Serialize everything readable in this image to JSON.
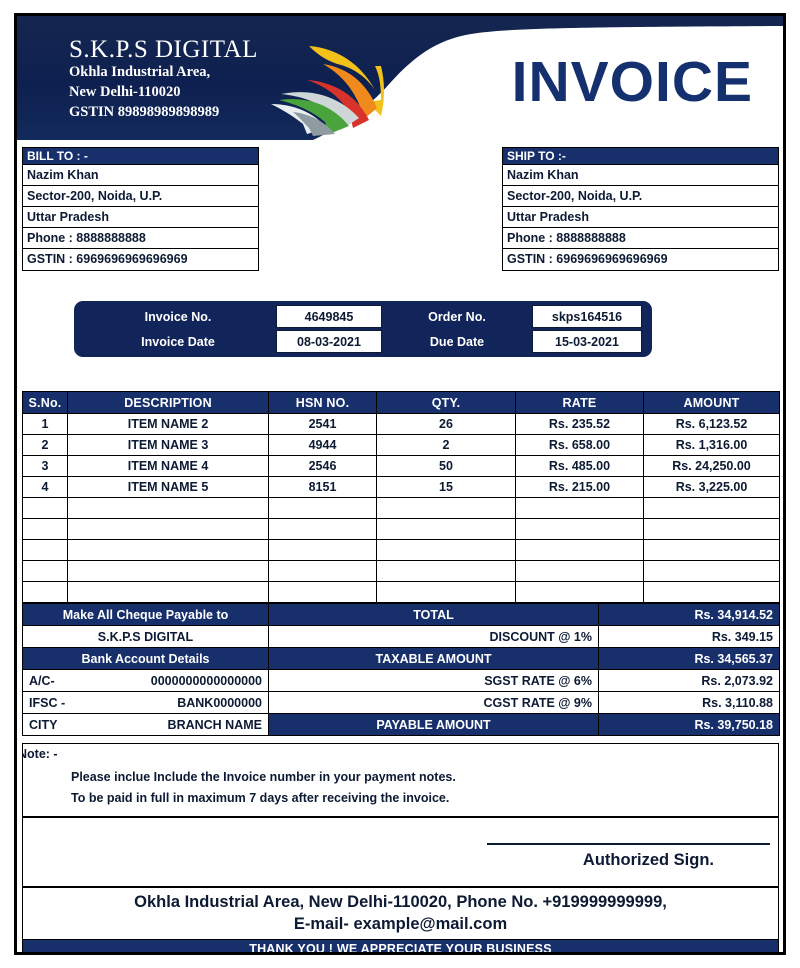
{
  "company": {
    "name": "S.K.P.S DIGITAL",
    "address_line1": "Okhla Industrial Area,",
    "address_line2": "New Delhi-110020",
    "gstin": "GSTIN 89898989898989"
  },
  "document": {
    "title": "INVOICE"
  },
  "bill_to": {
    "heading": "BILL TO : -",
    "name": "Nazim Khan",
    "address": "Sector-200, Noida, U.P.",
    "state": "Uttar Pradesh",
    "phone": "Phone : 8888888888",
    "gstin": "GSTIN : 6969696969696969"
  },
  "ship_to": {
    "heading": "SHIP TO  :-",
    "name": "Nazim Khan",
    "address": "Sector-200, Noida, U.P.",
    "state": "Uttar Pradesh",
    "phone": "Phone : 8888888888",
    "gstin": "GSTIN : 6969696969696969"
  },
  "meta": {
    "invoice_no_label": "Invoice No.",
    "invoice_no_value": "4649845",
    "order_no_label": "Order No.",
    "order_no_value": "skps164516",
    "invoice_date_label": "Invoice Date",
    "invoice_date_value": "08-03-2021",
    "due_date_label": "Due Date",
    "due_date_value": "15-03-2021"
  },
  "items_table": {
    "columns": [
      "S.No.",
      "DESCRIPTION",
      "HSN NO.",
      "QTY.",
      "RATE",
      "AMOUNT"
    ],
    "rows": [
      {
        "sno": "1",
        "description": "ITEM NAME 2",
        "hsn": "2541",
        "qty": "26",
        "rate": "Rs. 235.52",
        "amount": "Rs. 6,123.52"
      },
      {
        "sno": "2",
        "description": "ITEM NAME 3",
        "hsn": "4944",
        "qty": "2",
        "rate": "Rs. 658.00",
        "amount": "Rs. 1,316.00"
      },
      {
        "sno": "3",
        "description": "ITEM NAME 4",
        "hsn": "2546",
        "qty": "50",
        "rate": "Rs. 485.00",
        "amount": "Rs. 24,250.00"
      },
      {
        "sno": "4",
        "description": "ITEM NAME 5",
        "hsn": "8151",
        "qty": "15",
        "rate": "Rs. 215.00",
        "amount": "Rs. 3,225.00"
      }
    ],
    "empty_row_count": 5
  },
  "payment": {
    "cheque_payable_label": "Make All Cheque Payable to",
    "cheque_payable_value": "S.K.P.S DIGITAL",
    "bank_details_label": "Bank Account Details",
    "account_label": "A/C-",
    "account_value": "0000000000000000",
    "ifsc_label": "IFSC -",
    "ifsc_value": "BANK0000000",
    "city_label": "CITY",
    "branch_value": "BRANCH NAME"
  },
  "summary": {
    "rows": [
      {
        "label": "TOTAL",
        "value": "Rs. 34,914.52",
        "style": "navy"
      },
      {
        "label": "DISCOUNT @  1%",
        "value": "Rs. 349.15",
        "style": "plain"
      },
      {
        "label": "TAXABLE AMOUNT",
        "value": "Rs. 34,565.37",
        "style": "navy"
      },
      {
        "label": "SGST RATE @   6%",
        "value": "Rs. 2,073.92",
        "style": "plain"
      },
      {
        "label": "CGST RATE @  9%",
        "value": "Rs. 3,110.88",
        "style": "plain"
      },
      {
        "label": "PAYABLE AMOUNT",
        "value": "Rs. 39,750.18",
        "style": "navy"
      }
    ]
  },
  "note": {
    "label": "Note: -",
    "line1": "Please inclue Include the Invoice number in your payment notes.",
    "line2": "To be paid in full in maximum 7 days after receiving the invoice."
  },
  "signature": {
    "text": "Authorized Sign."
  },
  "footer": {
    "address_line1": "Okhla Industrial Area, New Delhi-110020, Phone No. +919999999999,",
    "address_line2": "E-mail- example@mail.com",
    "thank_you": "THANK YOU ! WE APPRECIATE YOUR BUSINESS"
  },
  "colors": {
    "navy": "#17306b",
    "deep_navy": "#11255a",
    "title_blue": "#15306e",
    "logo_yellow": "#f5c518",
    "logo_orange": "#f07c1e",
    "logo_red": "#d8312a",
    "logo_green": "#4aa43c",
    "logo_gray": "#9aa7ab"
  }
}
